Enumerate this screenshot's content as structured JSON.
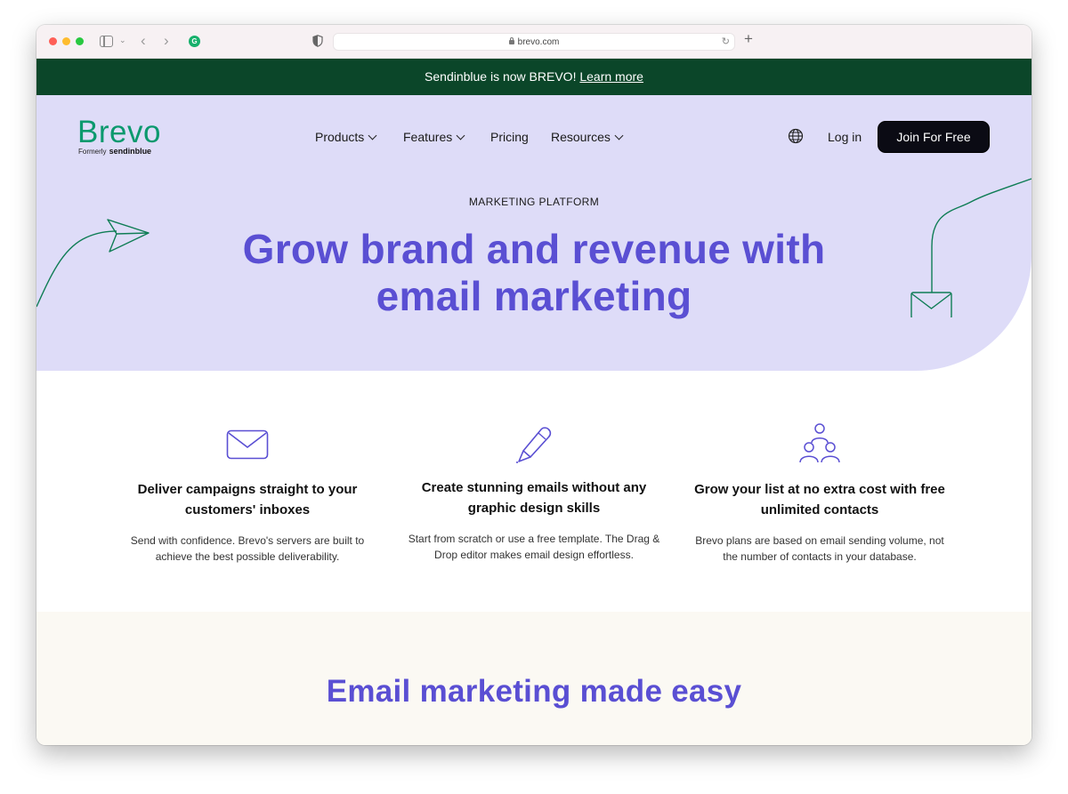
{
  "browser": {
    "url": "brevo.com"
  },
  "announcement": {
    "text": "Sendinblue is now BREVO!",
    "link": "Learn more"
  },
  "logo": {
    "name": "Brevo",
    "formerly": "Formerly",
    "former_name": "sendinblue"
  },
  "nav": {
    "items": [
      {
        "label": "Products"
      },
      {
        "label": "Features"
      },
      {
        "label": "Pricing"
      },
      {
        "label": "Resources"
      }
    ],
    "login": "Log in",
    "cta": "Join For Free"
  },
  "hero": {
    "eyebrow": "MARKETING PLATFORM",
    "title_line1": "Grow brand and revenue with",
    "title_line2": "email marketing"
  },
  "features": [
    {
      "icon": "envelope-icon",
      "title_line1": "Deliver campaigns straight to your",
      "title_line2": "customers' inboxes",
      "desc_line1": "Send with confidence. Brevo's servers are built to",
      "desc_line2": "achieve the best possible deliverability."
    },
    {
      "icon": "pencil-icon",
      "title_line1": "Create stunning emails without any",
      "title_line2": "graphic design skills",
      "desc_line1": "Start from scratch or use a free template. The Drag &",
      "desc_line2": "Drop editor makes email design effortless."
    },
    {
      "icon": "people-icon",
      "title_line1": "Grow your list at no extra cost with free",
      "title_line2": "unlimited contacts",
      "desc_line1": "Brevo plans are based on email sending volume, not",
      "desc_line2": "the number of contacts in your database."
    }
  ],
  "section2": {
    "title": "Email marketing made easy"
  },
  "colors": {
    "brand_green": "#0b996e",
    "announce_bg": "#0b4629",
    "hero_bg": "#dedcf8",
    "accent_purple": "#5a4fd3"
  }
}
